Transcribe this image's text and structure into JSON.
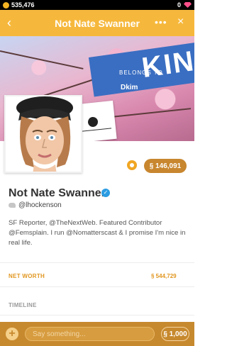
{
  "status_bar": {
    "balance": "535,476",
    "right_count": "0"
  },
  "header": {
    "title": "Not Nate Swanner",
    "back_icon": "‹",
    "more_icon": "•••",
    "close_icon": "×"
  },
  "cover": {
    "belongs_to_label": "BELONGS TO",
    "owner_name": "Dkim",
    "banner_text": "KIN"
  },
  "profile": {
    "price": "§ 146,091",
    "name": "Not Nate Swanner",
    "handle": "@lhockenson",
    "bio": "SF Reporter, @TheNextWeb. Featured Contributor @Femsplain. I run @Nomatterscast & I promise I'm nice in real life."
  },
  "stats": {
    "net_worth_label": "NET WORTH",
    "net_worth_value": "§ 544,729",
    "timeline_label": "TIMELINE"
  },
  "composer": {
    "placeholder": "Say something...",
    "price": "§ 1,000"
  },
  "colors": {
    "accent": "#f6b83c",
    "brand": "#c7892e",
    "verified": "#2b9ce2"
  }
}
